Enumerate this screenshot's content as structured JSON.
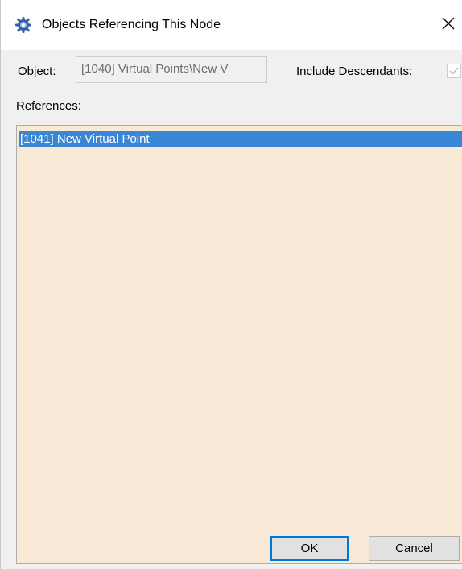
{
  "window": {
    "title": "Objects Referencing This Node",
    "app_icon": "gear-icon",
    "close_icon": "close-icon"
  },
  "object": {
    "label": "Object:",
    "value": "[1040] Virtual Points\\New V"
  },
  "include_descendants": {
    "label": "Include Descendants:",
    "checked": true,
    "disabled": true
  },
  "references": {
    "label": "References:",
    "items": [
      {
        "label": "[1041] New Virtual Point",
        "selected": true
      }
    ]
  },
  "buttons": {
    "ok_label": "OK",
    "cancel_label": "Cancel"
  },
  "colors": {
    "list_background": "#f9e9d7",
    "selection": "#3a8bd9",
    "accent": "#0078d7"
  }
}
